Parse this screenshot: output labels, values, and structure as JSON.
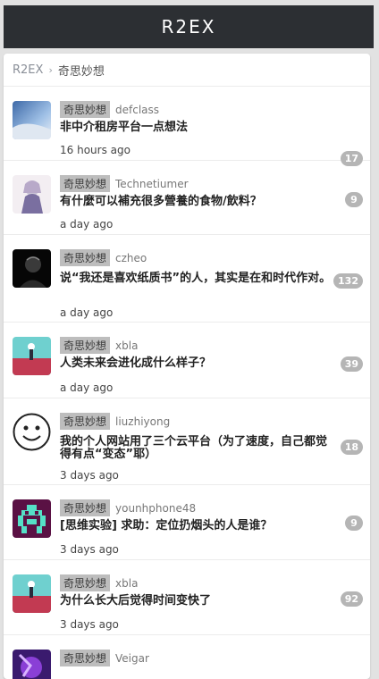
{
  "site": {
    "title": "R2EX"
  },
  "breadcrumb": {
    "home": "R2EX",
    "separator": "›",
    "current": "奇思妙想"
  },
  "topics": [
    {
      "node": "奇思妙想",
      "user": "defclass",
      "title": "非中介租房平台一点想法",
      "time": "16 hours ago",
      "replies": "17",
      "avatar": "sky-photo"
    },
    {
      "node": "奇思妙想",
      "user": "Technetiumer",
      "title": "有什麼可以補充很多營養的食物/飲料？",
      "time": "a day ago",
      "replies": "9",
      "avatar": "anime-character"
    },
    {
      "node": "奇思妙想",
      "user": "czheo",
      "title": "说“我还是喜欢纸质书”的人，其实是在和时代作对。",
      "time": "a day ago",
      "replies": "132",
      "avatar": "dark-portrait"
    },
    {
      "node": "奇思妙想",
      "user": "xbla",
      "title": "人类未来会进化成什么样子？",
      "time": "a day ago",
      "replies": "39",
      "avatar": "landscape-game"
    },
    {
      "node": "奇思妙想",
      "user": "liuzhiyong",
      "title": "我的个人网站用了三个云平台（为了速度，自己都觉得有点“变态”耶）",
      "time": "3 days ago",
      "replies": "18",
      "avatar": "smiley-face"
    },
    {
      "node": "奇思妙想",
      "user": "younhphone48",
      "title": "[思维实验] 求助：定位扔烟头的人是谁？",
      "time": "3 days ago",
      "replies": "9",
      "avatar": "pixel-invader"
    },
    {
      "node": "奇思妙想",
      "user": "xbla",
      "title": "为什么长大后觉得时间变快了",
      "time": "3 days ago",
      "replies": "92",
      "avatar": "landscape-game"
    },
    {
      "node": "奇思妙想",
      "user": "Veigar",
      "title": "",
      "time": "",
      "replies": "",
      "avatar": "purple-wizard"
    }
  ]
}
